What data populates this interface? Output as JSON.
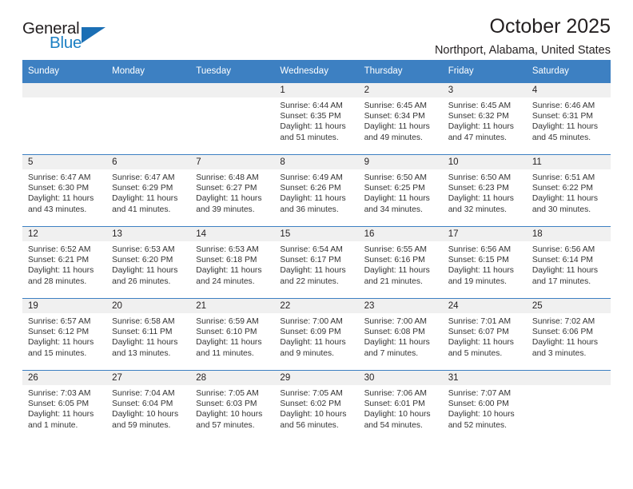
{
  "brand": {
    "name_top": "General",
    "name_bottom": "Blue",
    "accent_color": "#1b7fc3",
    "triangle_color": "#1b6fb5",
    "triangle_icon": "triangle-icon"
  },
  "header": {
    "title": "October 2025",
    "subtitle": "Northport, Alabama, United States"
  },
  "colors": {
    "header_row_bg": "#3d80c2",
    "daynum_band_bg": "#f0f0f0",
    "row_border": "#3d80c2",
    "text": "#231f20"
  },
  "weekday_headers": [
    "Sunday",
    "Monday",
    "Tuesday",
    "Wednesday",
    "Thursday",
    "Friday",
    "Saturday"
  ],
  "weeks": [
    [
      {
        "day": "",
        "empty": true
      },
      {
        "day": "",
        "empty": true
      },
      {
        "day": "",
        "empty": true
      },
      {
        "day": "1",
        "sunrise": "Sunrise: 6:44 AM",
        "sunset": "Sunset: 6:35 PM",
        "daylight_line1": "Daylight: 11 hours",
        "daylight_line2": "and 51 minutes."
      },
      {
        "day": "2",
        "sunrise": "Sunrise: 6:45 AM",
        "sunset": "Sunset: 6:34 PM",
        "daylight_line1": "Daylight: 11 hours",
        "daylight_line2": "and 49 minutes."
      },
      {
        "day": "3",
        "sunrise": "Sunrise: 6:45 AM",
        "sunset": "Sunset: 6:32 PM",
        "daylight_line1": "Daylight: 11 hours",
        "daylight_line2": "and 47 minutes."
      },
      {
        "day": "4",
        "sunrise": "Sunrise: 6:46 AM",
        "sunset": "Sunset: 6:31 PM",
        "daylight_line1": "Daylight: 11 hours",
        "daylight_line2": "and 45 minutes."
      }
    ],
    [
      {
        "day": "5",
        "sunrise": "Sunrise: 6:47 AM",
        "sunset": "Sunset: 6:30 PM",
        "daylight_line1": "Daylight: 11 hours",
        "daylight_line2": "and 43 minutes."
      },
      {
        "day": "6",
        "sunrise": "Sunrise: 6:47 AM",
        "sunset": "Sunset: 6:29 PM",
        "daylight_line1": "Daylight: 11 hours",
        "daylight_line2": "and 41 minutes."
      },
      {
        "day": "7",
        "sunrise": "Sunrise: 6:48 AM",
        "sunset": "Sunset: 6:27 PM",
        "daylight_line1": "Daylight: 11 hours",
        "daylight_line2": "and 39 minutes."
      },
      {
        "day": "8",
        "sunrise": "Sunrise: 6:49 AM",
        "sunset": "Sunset: 6:26 PM",
        "daylight_line1": "Daylight: 11 hours",
        "daylight_line2": "and 36 minutes."
      },
      {
        "day": "9",
        "sunrise": "Sunrise: 6:50 AM",
        "sunset": "Sunset: 6:25 PM",
        "daylight_line1": "Daylight: 11 hours",
        "daylight_line2": "and 34 minutes."
      },
      {
        "day": "10",
        "sunrise": "Sunrise: 6:50 AM",
        "sunset": "Sunset: 6:23 PM",
        "daylight_line1": "Daylight: 11 hours",
        "daylight_line2": "and 32 minutes."
      },
      {
        "day": "11",
        "sunrise": "Sunrise: 6:51 AM",
        "sunset": "Sunset: 6:22 PM",
        "daylight_line1": "Daylight: 11 hours",
        "daylight_line2": "and 30 minutes."
      }
    ],
    [
      {
        "day": "12",
        "sunrise": "Sunrise: 6:52 AM",
        "sunset": "Sunset: 6:21 PM",
        "daylight_line1": "Daylight: 11 hours",
        "daylight_line2": "and 28 minutes."
      },
      {
        "day": "13",
        "sunrise": "Sunrise: 6:53 AM",
        "sunset": "Sunset: 6:20 PM",
        "daylight_line1": "Daylight: 11 hours",
        "daylight_line2": "and 26 minutes."
      },
      {
        "day": "14",
        "sunrise": "Sunrise: 6:53 AM",
        "sunset": "Sunset: 6:18 PM",
        "daylight_line1": "Daylight: 11 hours",
        "daylight_line2": "and 24 minutes."
      },
      {
        "day": "15",
        "sunrise": "Sunrise: 6:54 AM",
        "sunset": "Sunset: 6:17 PM",
        "daylight_line1": "Daylight: 11 hours",
        "daylight_line2": "and 22 minutes."
      },
      {
        "day": "16",
        "sunrise": "Sunrise: 6:55 AM",
        "sunset": "Sunset: 6:16 PM",
        "daylight_line1": "Daylight: 11 hours",
        "daylight_line2": "and 21 minutes."
      },
      {
        "day": "17",
        "sunrise": "Sunrise: 6:56 AM",
        "sunset": "Sunset: 6:15 PM",
        "daylight_line1": "Daylight: 11 hours",
        "daylight_line2": "and 19 minutes."
      },
      {
        "day": "18",
        "sunrise": "Sunrise: 6:56 AM",
        "sunset": "Sunset: 6:14 PM",
        "daylight_line1": "Daylight: 11 hours",
        "daylight_line2": "and 17 minutes."
      }
    ],
    [
      {
        "day": "19",
        "sunrise": "Sunrise: 6:57 AM",
        "sunset": "Sunset: 6:12 PM",
        "daylight_line1": "Daylight: 11 hours",
        "daylight_line2": "and 15 minutes."
      },
      {
        "day": "20",
        "sunrise": "Sunrise: 6:58 AM",
        "sunset": "Sunset: 6:11 PM",
        "daylight_line1": "Daylight: 11 hours",
        "daylight_line2": "and 13 minutes."
      },
      {
        "day": "21",
        "sunrise": "Sunrise: 6:59 AM",
        "sunset": "Sunset: 6:10 PM",
        "daylight_line1": "Daylight: 11 hours",
        "daylight_line2": "and 11 minutes."
      },
      {
        "day": "22",
        "sunrise": "Sunrise: 7:00 AM",
        "sunset": "Sunset: 6:09 PM",
        "daylight_line1": "Daylight: 11 hours",
        "daylight_line2": "and 9 minutes."
      },
      {
        "day": "23",
        "sunrise": "Sunrise: 7:00 AM",
        "sunset": "Sunset: 6:08 PM",
        "daylight_line1": "Daylight: 11 hours",
        "daylight_line2": "and 7 minutes."
      },
      {
        "day": "24",
        "sunrise": "Sunrise: 7:01 AM",
        "sunset": "Sunset: 6:07 PM",
        "daylight_line1": "Daylight: 11 hours",
        "daylight_line2": "and 5 minutes."
      },
      {
        "day": "25",
        "sunrise": "Sunrise: 7:02 AM",
        "sunset": "Sunset: 6:06 PM",
        "daylight_line1": "Daylight: 11 hours",
        "daylight_line2": "and 3 minutes."
      }
    ],
    [
      {
        "day": "26",
        "sunrise": "Sunrise: 7:03 AM",
        "sunset": "Sunset: 6:05 PM",
        "daylight_line1": "Daylight: 11 hours",
        "daylight_line2": "and 1 minute."
      },
      {
        "day": "27",
        "sunrise": "Sunrise: 7:04 AM",
        "sunset": "Sunset: 6:04 PM",
        "daylight_line1": "Daylight: 10 hours",
        "daylight_line2": "and 59 minutes."
      },
      {
        "day": "28",
        "sunrise": "Sunrise: 7:05 AM",
        "sunset": "Sunset: 6:03 PM",
        "daylight_line1": "Daylight: 10 hours",
        "daylight_line2": "and 57 minutes."
      },
      {
        "day": "29",
        "sunrise": "Sunrise: 7:05 AM",
        "sunset": "Sunset: 6:02 PM",
        "daylight_line1": "Daylight: 10 hours",
        "daylight_line2": "and 56 minutes."
      },
      {
        "day": "30",
        "sunrise": "Sunrise: 7:06 AM",
        "sunset": "Sunset: 6:01 PM",
        "daylight_line1": "Daylight: 10 hours",
        "daylight_line2": "and 54 minutes."
      },
      {
        "day": "31",
        "sunrise": "Sunrise: 7:07 AM",
        "sunset": "Sunset: 6:00 PM",
        "daylight_line1": "Daylight: 10 hours",
        "daylight_line2": "and 52 minutes."
      },
      {
        "day": "",
        "empty": true
      }
    ]
  ]
}
